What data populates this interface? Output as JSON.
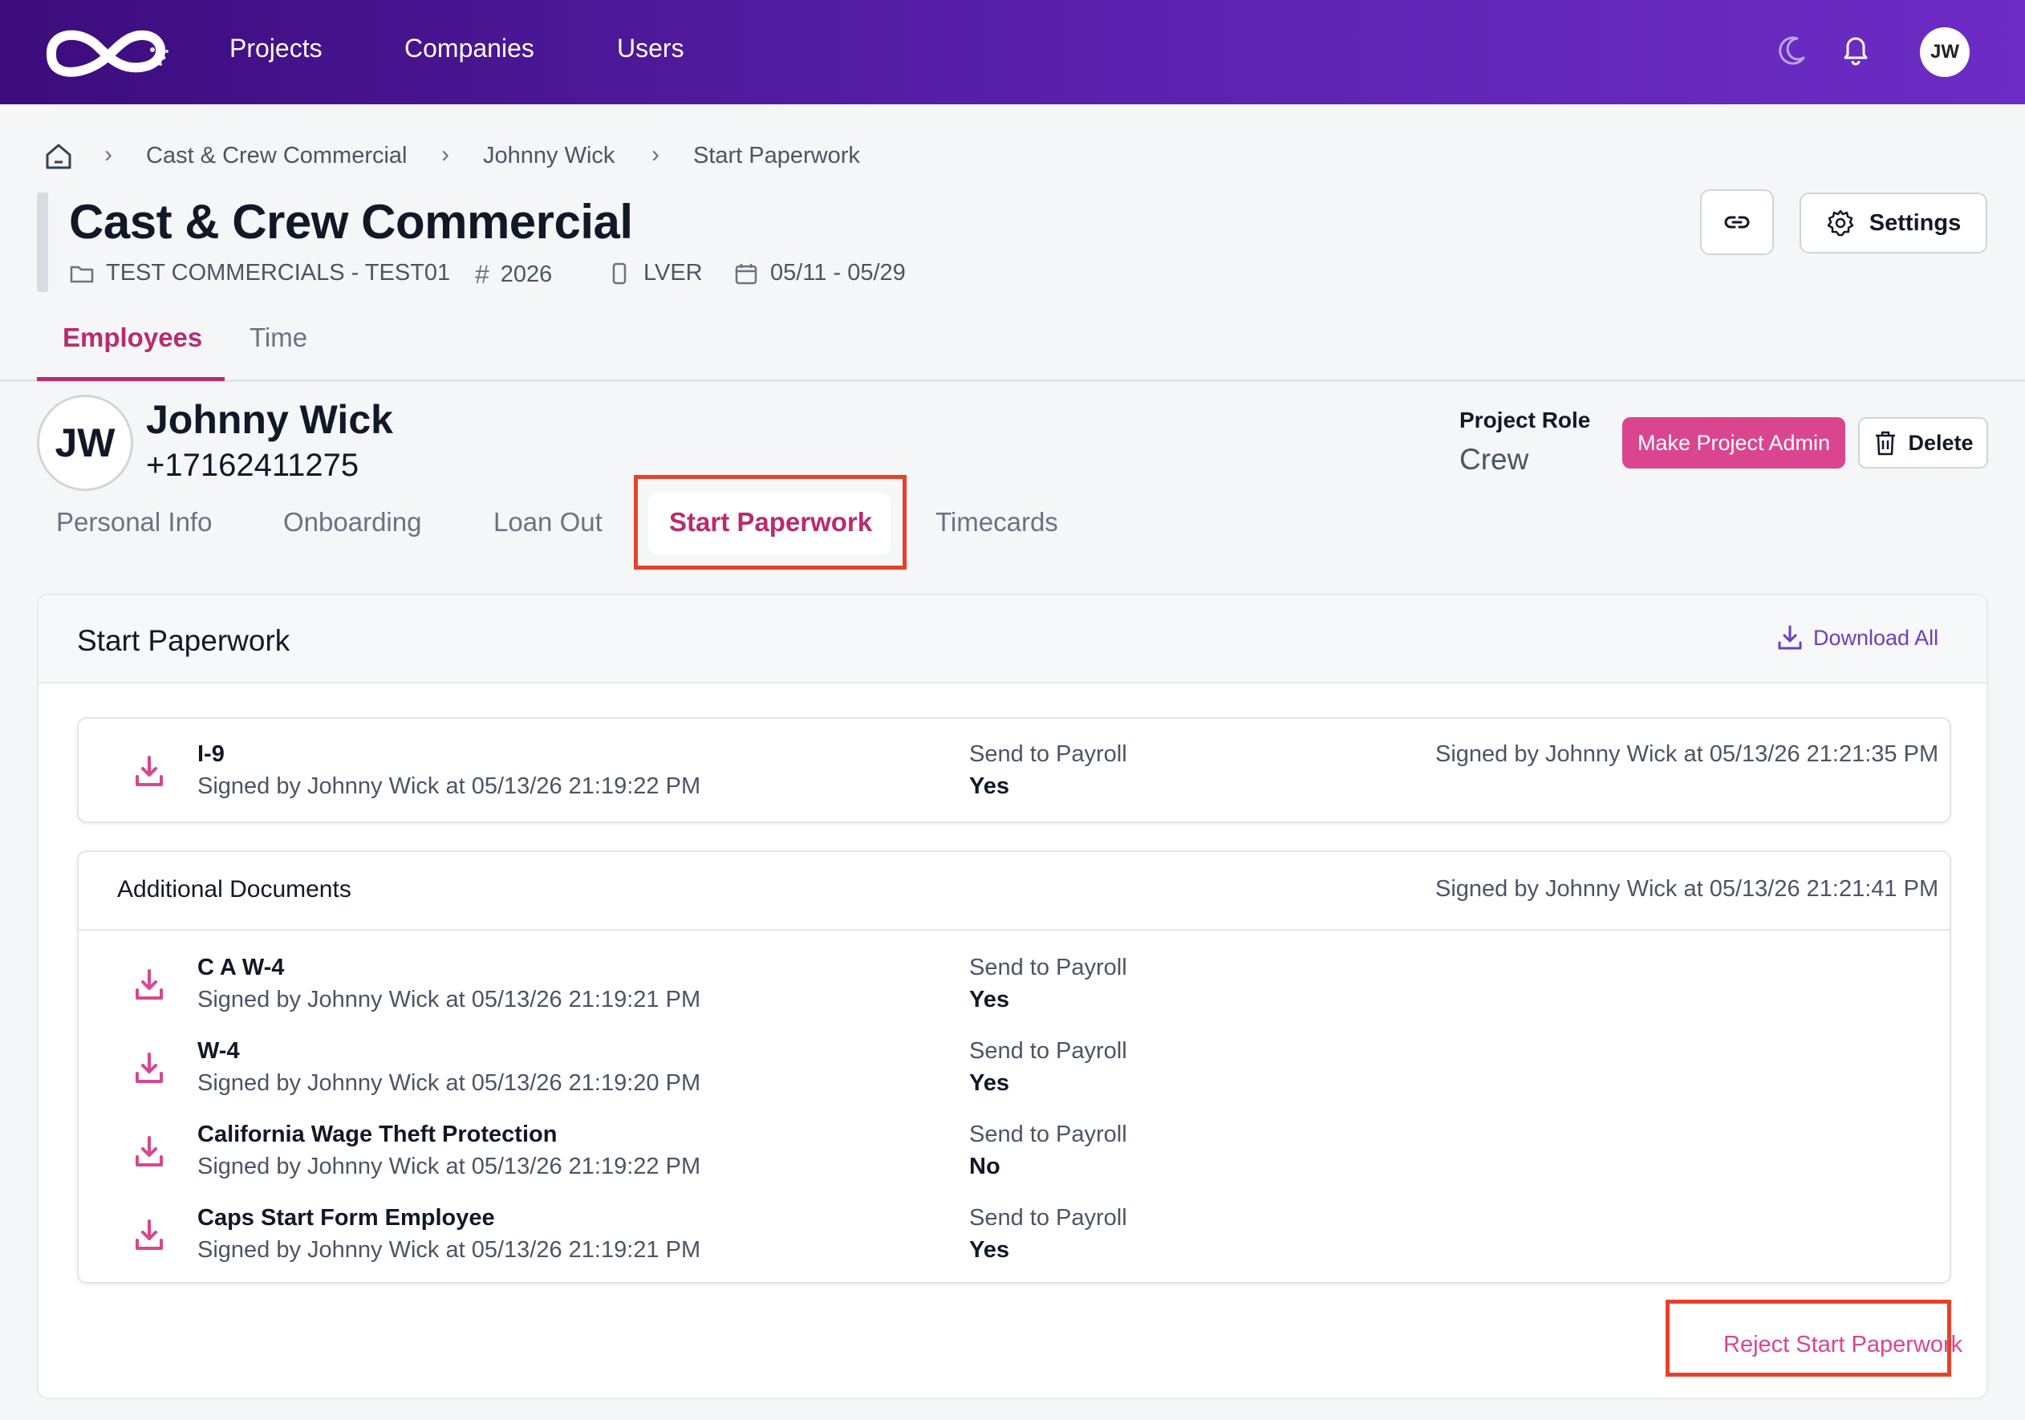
{
  "topnav": {
    "links": [
      "Projects",
      "Companies",
      "Users"
    ],
    "avatar_initials": "JW",
    "icons": [
      "logo-icon",
      "moon-icon",
      "bell-icon"
    ]
  },
  "breadcrumb": {
    "items": [
      "Cast & Crew Commercial",
      "Johnny Wick",
      "Start Paperwork"
    ]
  },
  "project": {
    "title": "Cast & Crew Commercial",
    "company": "TEST COMMERCIALS - TEST01",
    "number": "2026",
    "code": "LVER",
    "dates": "05/11 - 05/29",
    "settings_label": "Settings"
  },
  "main_tabs": [
    "Employees",
    "Time"
  ],
  "employee": {
    "initials": "JW",
    "name": "Johnny Wick",
    "phone": "+17162411275",
    "role_label": "Project Role",
    "role_value": "Crew",
    "make_admin_label": "Make Project Admin",
    "delete_label": "Delete"
  },
  "sub_tabs": [
    "Personal Info",
    "Onboarding",
    "Loan Out",
    "Start Paperwork",
    "Timecards"
  ],
  "paperwork": {
    "title": "Start Paperwork",
    "download_all_label": "Download All",
    "primary_doc": {
      "name": "I-9",
      "signed": "Signed by Johnny Wick at 05/13/26 21:19:22 PM",
      "send_label": "Send to Payroll",
      "send_value": "Yes",
      "right_signed": "Signed by Johnny Wick at 05/13/26 21:21:35 PM"
    },
    "additional": {
      "title": "Additional Documents",
      "right_signed": "Signed by Johnny Wick at 05/13/26 21:21:41 PM",
      "docs": [
        {
          "name": "C A W-4",
          "signed": "Signed by Johnny Wick at 05/13/26 21:19:21 PM",
          "send_label": "Send to Payroll",
          "send_value": "Yes"
        },
        {
          "name": "W-4",
          "signed": "Signed by Johnny Wick at 05/13/26 21:19:20 PM",
          "send_label": "Send to Payroll",
          "send_value": "Yes"
        },
        {
          "name": "California Wage Theft Protection",
          "signed": "Signed by Johnny Wick at 05/13/26 21:19:22 PM",
          "send_label": "Send to Payroll",
          "send_value": "No"
        },
        {
          "name": "Caps Start Form Employee",
          "signed": "Signed by Johnny Wick at 05/13/26 21:19:21 PM",
          "send_label": "Send to Payroll",
          "send_value": "Yes"
        }
      ]
    },
    "reject_label": "Reject Start Paperwork"
  },
  "colors": {
    "accent": "#b92b6e",
    "admin_button": "#d9468f",
    "link_purple": "#6b3fc1",
    "highlight": "#e8412a"
  }
}
